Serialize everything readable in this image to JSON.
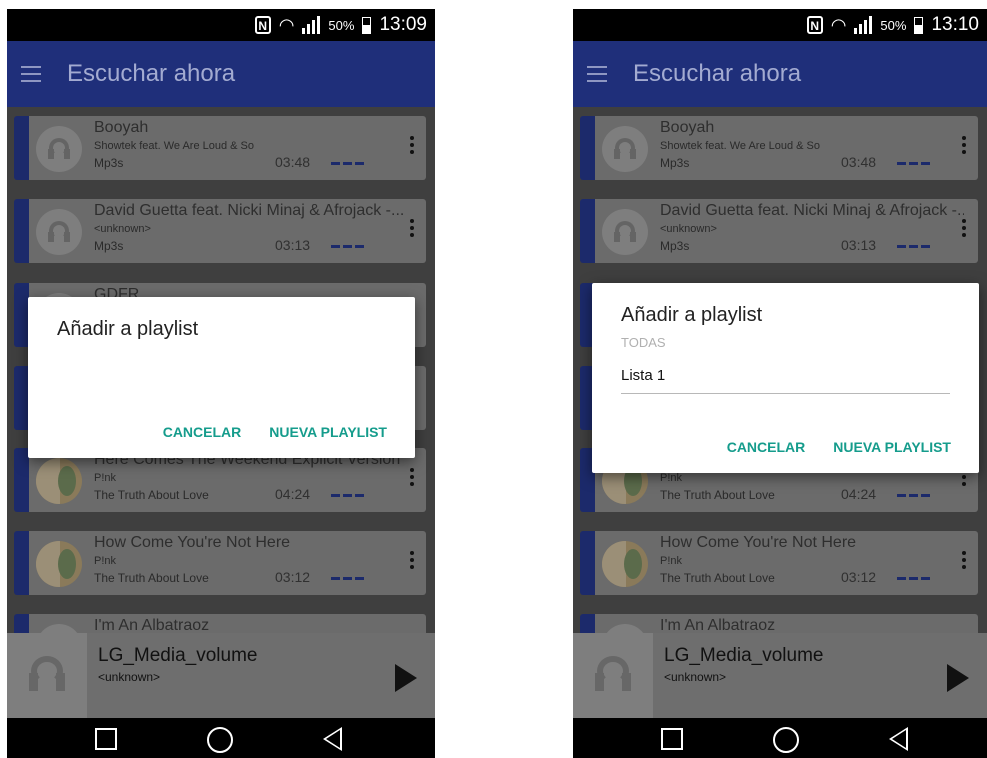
{
  "screens": [
    {
      "status": {
        "battery": "50%",
        "time": "13:09"
      },
      "app_bar": {
        "title": "Escuchar ahora"
      },
      "tracks": [
        {
          "title": "Booyah",
          "artist": "Showtek feat. We Are Loud & So",
          "album": "Mp3s",
          "duration": "03:48",
          "art": "headphone"
        },
        {
          "title": "David Guetta feat. Nicki Minaj & Afrojack -...",
          "artist": "<unknown>",
          "album": "Mp3s",
          "duration": "03:13",
          "art": "headphone"
        },
        {
          "title": "GDFR",
          "artist": "",
          "album": "",
          "duration": "",
          "art": "headphone"
        },
        {
          "title": "",
          "artist": "",
          "album": "",
          "duration": "",
          "art": "headphone"
        },
        {
          "title": "Here Comes The Weekend Explicit Version",
          "artist": "P!nk",
          "album": "The Truth About Love",
          "duration": "04:24",
          "art": "album"
        },
        {
          "title": "How Come You're Not Here",
          "artist": "P!nk",
          "album": "The Truth About Love",
          "duration": "03:12",
          "art": "album"
        },
        {
          "title": "I'm An Albatraoz",
          "artist": "",
          "album": "",
          "duration": "",
          "art": "headphone"
        }
      ],
      "now_playing": {
        "title": "LG_Media_volume",
        "artist": "<unknown>"
      },
      "dialog": {
        "title": "Añadir a playlist",
        "section_label": "",
        "items": [],
        "cancel": "CANCELAR",
        "new_playlist": "NUEVA PLAYLIST"
      }
    },
    {
      "status": {
        "battery": "50%",
        "time": "13:10"
      },
      "app_bar": {
        "title": "Escuchar ahora"
      },
      "tracks": [
        {
          "title": "Booyah",
          "artist": "Showtek feat. We Are Loud & So",
          "album": "Mp3s",
          "duration": "03:48",
          "art": "headphone"
        },
        {
          "title": "David Guetta feat. Nicki Minaj & Afrojack -...",
          "artist": "<unknown>",
          "album": "Mp3s",
          "duration": "03:13",
          "art": "headphone"
        },
        {
          "title": "",
          "artist": "",
          "album": "",
          "duration": "",
          "art": "headphone"
        },
        {
          "title": "",
          "artist": "",
          "album": "",
          "duration": "",
          "art": "headphone"
        },
        {
          "title": "",
          "artist": "P!nk",
          "album": "The Truth About Love",
          "duration": "04:24",
          "art": "album"
        },
        {
          "title": "How Come You're Not Here",
          "artist": "P!nk",
          "album": "The Truth About Love",
          "duration": "03:12",
          "art": "album"
        },
        {
          "title": "I'm An Albatraoz",
          "artist": "",
          "album": "",
          "duration": "",
          "art": "headphone"
        }
      ],
      "now_playing": {
        "title": "LG_Media_volume",
        "artist": "<unknown>"
      },
      "dialog": {
        "title": "Añadir a playlist",
        "section_label": "TODAS",
        "items": [
          "Lista 1"
        ],
        "cancel": "CANCELAR",
        "new_playlist": "NUEVA PLAYLIST"
      }
    }
  ]
}
